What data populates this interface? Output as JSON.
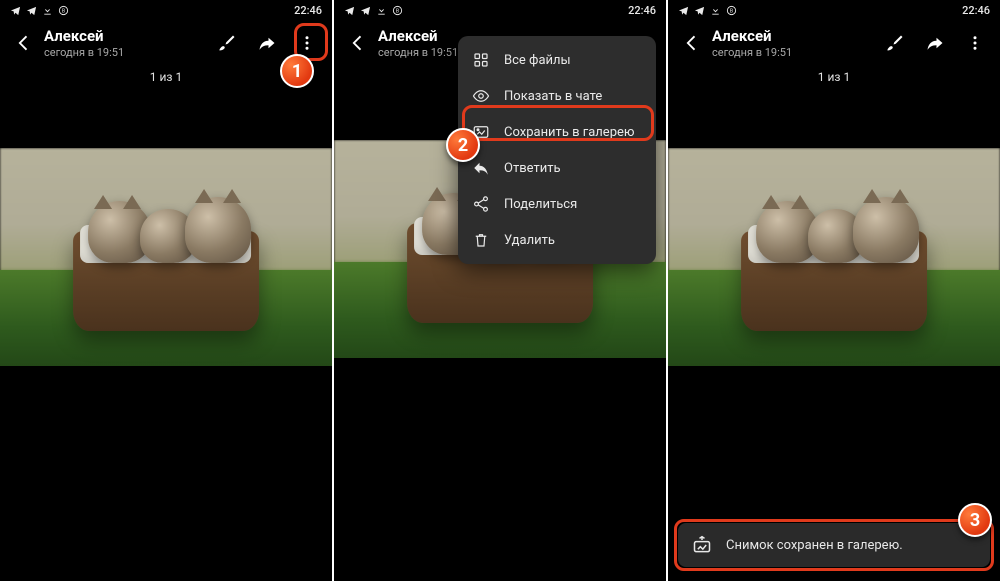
{
  "status": {
    "time": "22:46"
  },
  "header": {
    "name": "Алексей",
    "subtitle": "сегодня в 19:51"
  },
  "counter": "1 из 1",
  "menu": {
    "items": [
      {
        "label": "Все файлы"
      },
      {
        "label": "Показать в чате"
      },
      {
        "label": "Сохранить в галерею"
      },
      {
        "label": "Ответить"
      },
      {
        "label": "Поделиться"
      },
      {
        "label": "Удалить"
      }
    ]
  },
  "toast": {
    "text": "Снимок сохранен в галерею."
  },
  "badges": {
    "b1": "1",
    "b2": "2",
    "b3": "3"
  }
}
